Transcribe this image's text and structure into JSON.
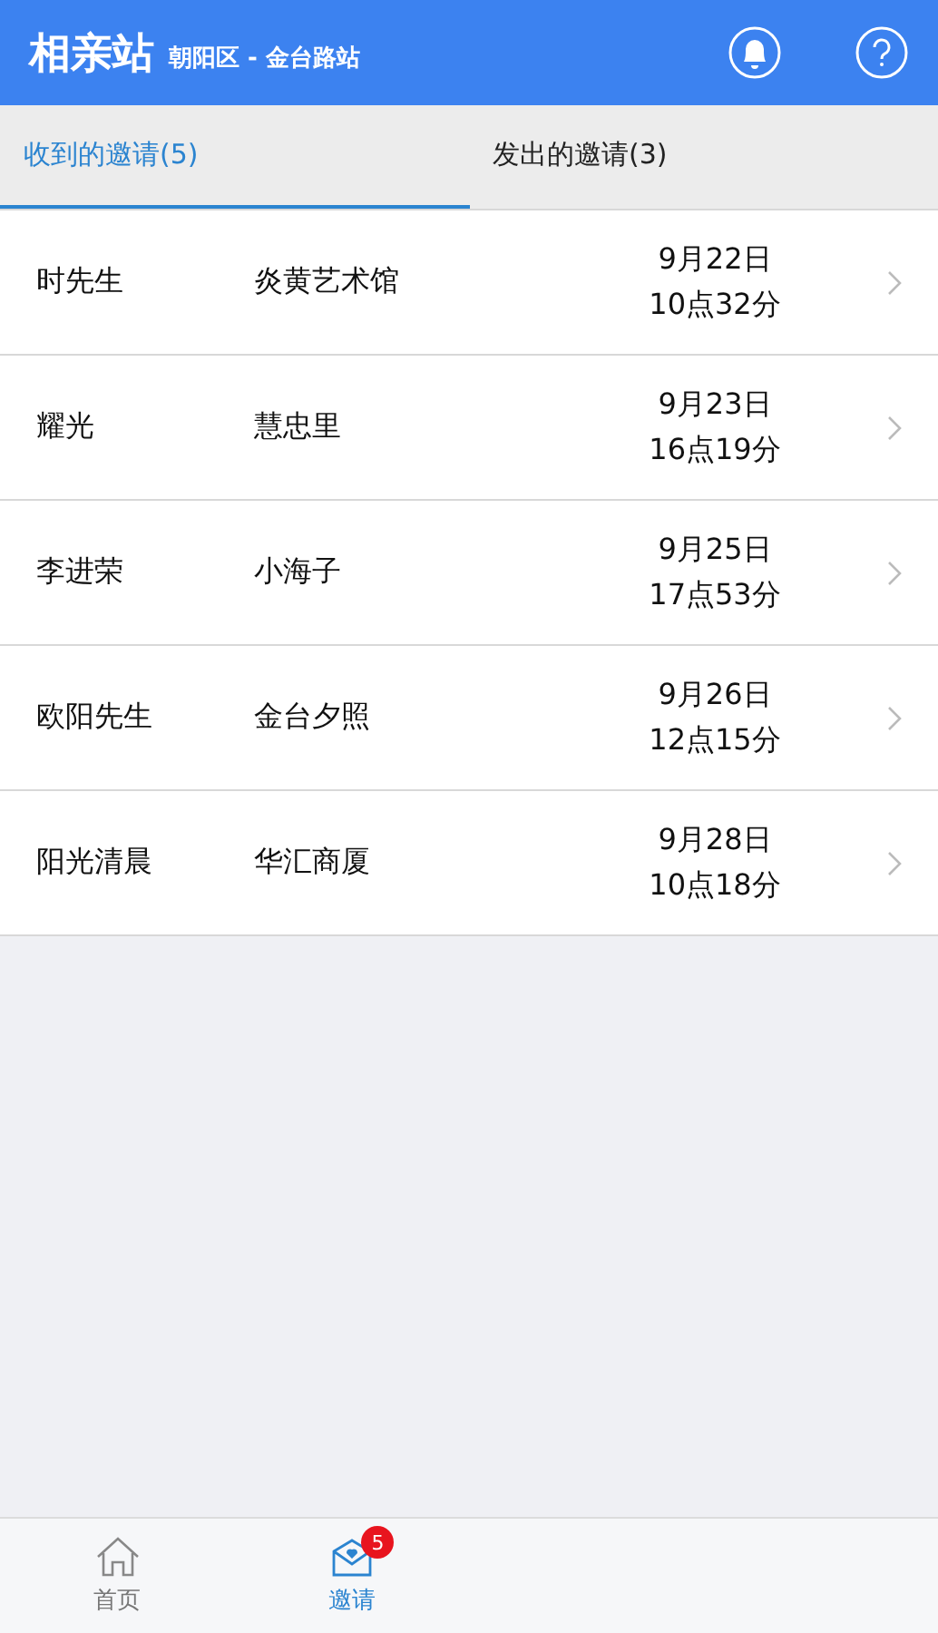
{
  "header": {
    "title": "相亲站",
    "subtitle": "朝阳区 - 金台路站"
  },
  "tabs": [
    {
      "label": "收到的邀请(5)",
      "selected": true
    },
    {
      "label": "发出的邀请(3)",
      "selected": false
    }
  ],
  "invitations": [
    {
      "name": "时先生",
      "place": "炎黄艺术馆",
      "date": "9月22日",
      "time": "10点32分"
    },
    {
      "name": "耀光",
      "place": "慧忠里",
      "date": "9月23日",
      "time": "16点19分"
    },
    {
      "name": "李进荣",
      "place": "小海子",
      "date": "9月25日",
      "time": "17点53分"
    },
    {
      "name": "欧阳先生",
      "place": "金台夕照",
      "date": "9月26日",
      "time": "12点15分"
    },
    {
      "name": "阳光清晨",
      "place": "华汇商厦",
      "date": "9月28日",
      "time": "10点18分"
    }
  ],
  "bottom_nav": [
    {
      "label": "首页",
      "kind": "home",
      "selected": false
    },
    {
      "label": "邀请",
      "kind": "mail",
      "selected": true,
      "badge": "5"
    }
  ]
}
